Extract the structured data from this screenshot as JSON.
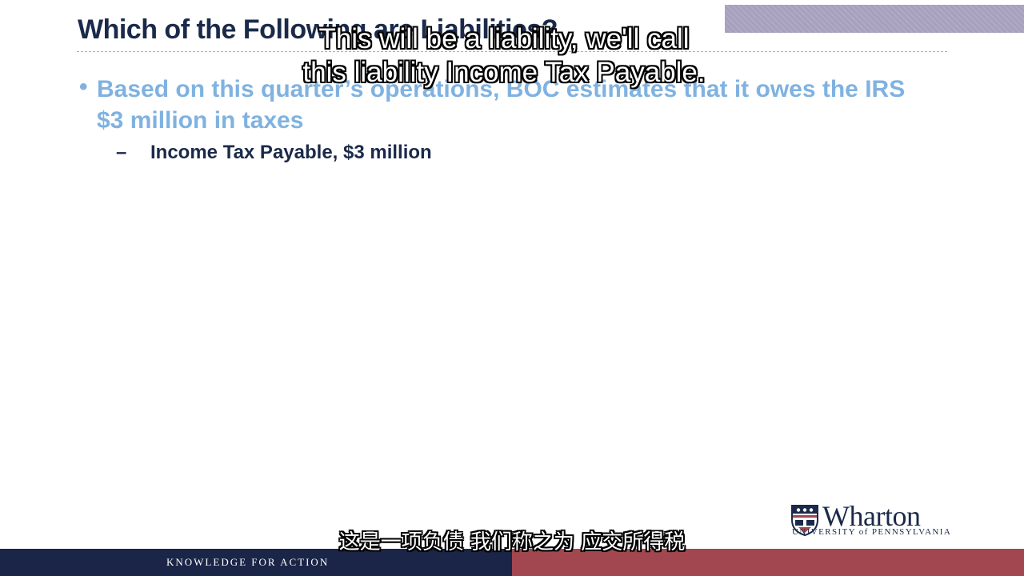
{
  "slide": {
    "title": "Which of the Following are Liabilities?",
    "bullet": {
      "symbol": "•",
      "text": "Based on this quarter’s operations, BOC estimates that it owes the IRS $3 million in taxes"
    },
    "sub_item": {
      "symbol": "–",
      "text": "Income Tax Payable, $3 million"
    }
  },
  "captions": {
    "english_line1": "This will be a liability, we'll call",
    "english_line2": "this liability Income Tax Payable.",
    "chinese": "这是一项负债 我们称之为 应交所得税"
  },
  "logo": {
    "name": "Wharton",
    "subtitle": "UNIVERSITY of PENNSYLVANIA"
  },
  "footer": {
    "tagline": "KNOWLEDGE FOR ACTION"
  },
  "colors": {
    "title": "#1b2a4a",
    "bullet": "#7fb2e0",
    "footer_left": "#1a2547",
    "footer_right": "#a2474f"
  }
}
